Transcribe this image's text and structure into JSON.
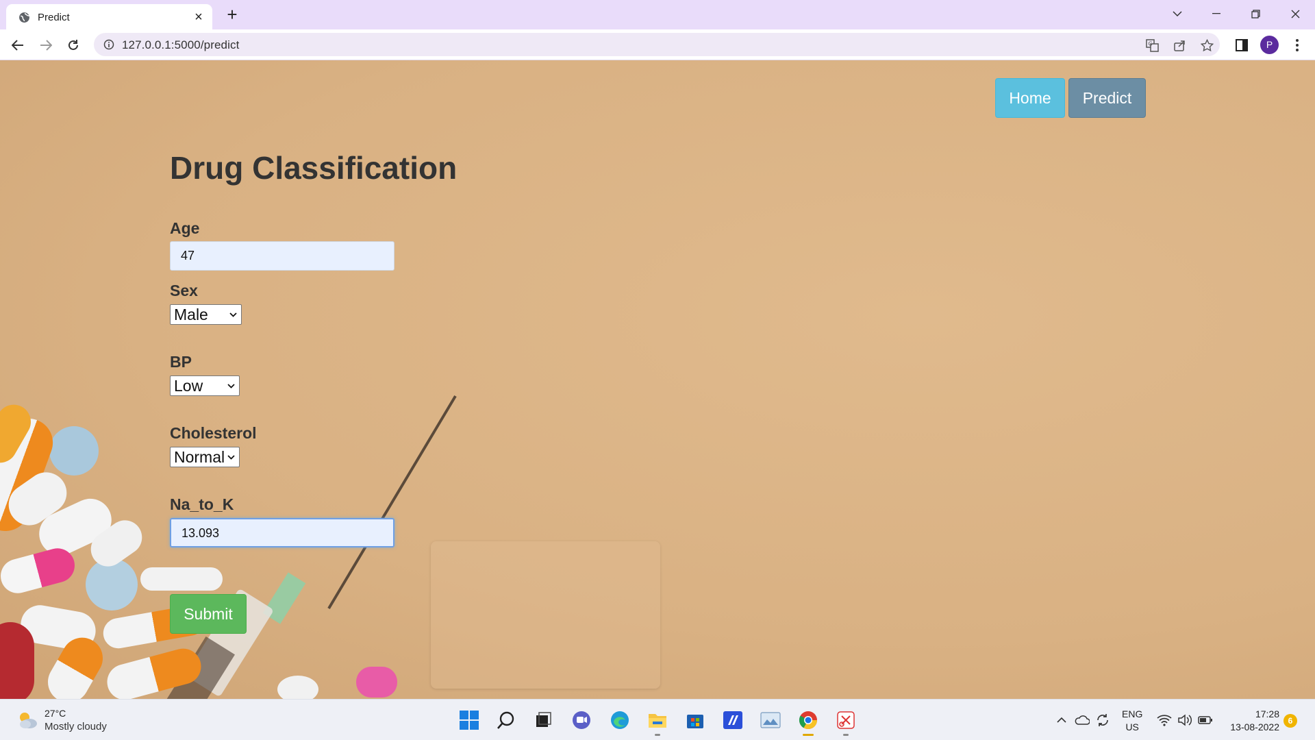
{
  "browser": {
    "tab_title": "Predict",
    "url": "127.0.0.1:5000/predict",
    "profile_initial": "P"
  },
  "nav": {
    "home_label": "Home",
    "predict_label": "Predict"
  },
  "form": {
    "title": "Drug Classification",
    "age": {
      "label": "Age",
      "value": "47"
    },
    "sex": {
      "label": "Sex",
      "selected": "Male"
    },
    "bp": {
      "label": "BP",
      "selected": "Low"
    },
    "cholesterol": {
      "label": "Cholesterol",
      "selected": "Normal"
    },
    "na_to_k": {
      "label": "Na_to_K",
      "value": "13.093"
    },
    "submit_label": "Submit"
  },
  "taskbar": {
    "weather_temp": "27°C",
    "weather_desc": "Mostly cloudy",
    "lang_line1": "ENG",
    "lang_line2": "US",
    "time": "17:28",
    "date": "13-08-2022",
    "notification_count": "6"
  },
  "colors": {
    "home_button": "#5bc0de",
    "predict_button": "#6c8ea4",
    "submit_button": "#5cb85c",
    "page_background": "#dcb487",
    "tabbar": "#e9dcfa"
  }
}
